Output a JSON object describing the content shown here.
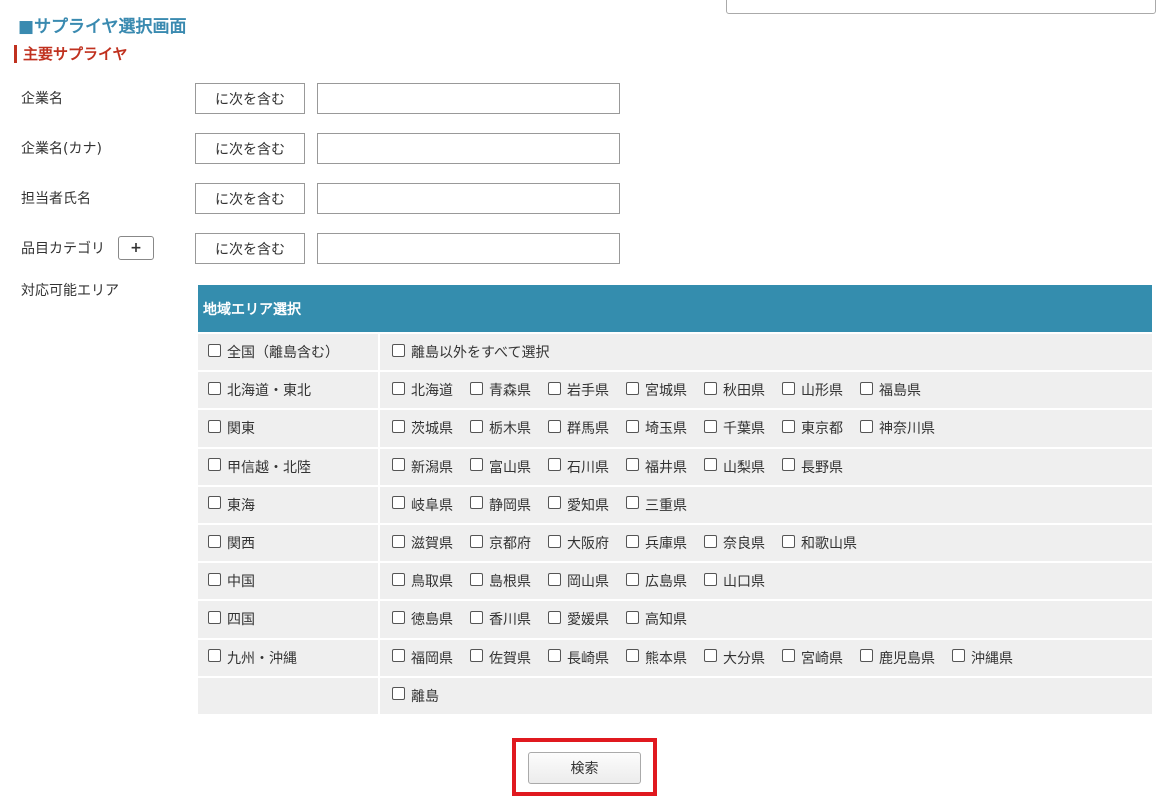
{
  "page": {
    "title": "サプライヤ選択画面",
    "title_marker": "■",
    "subtitle": "主要サプライヤ"
  },
  "fields": [
    {
      "label": "企業名",
      "condition": "に次を含む",
      "value": ""
    },
    {
      "label": "企業名(カナ)",
      "condition": "に次を含む",
      "value": ""
    },
    {
      "label": "担当者氏名",
      "condition": "に次を含む",
      "value": ""
    },
    {
      "label": "品目カテゴリ",
      "condition": "に次を含む",
      "value": ""
    }
  ],
  "category_add_label": "+",
  "area": {
    "label": "対応可能エリア",
    "header": "地域エリア選択",
    "rows": [
      {
        "region": "全国（離島含む）",
        "prefectures": [
          "離島以外をすべて選択"
        ]
      },
      {
        "region": "北海道・東北",
        "prefectures": [
          "北海道",
          "青森県",
          "岩手県",
          "宮城県",
          "秋田県",
          "山形県",
          "福島県"
        ]
      },
      {
        "region": "関東",
        "prefectures": [
          "茨城県",
          "栃木県",
          "群馬県",
          "埼玉県",
          "千葉県",
          "東京都",
          "神奈川県"
        ]
      },
      {
        "region": "甲信越・北陸",
        "prefectures": [
          "新潟県",
          "富山県",
          "石川県",
          "福井県",
          "山梨県",
          "長野県"
        ]
      },
      {
        "region": "東海",
        "prefectures": [
          "岐阜県",
          "静岡県",
          "愛知県",
          "三重県"
        ]
      },
      {
        "region": "関西",
        "prefectures": [
          "滋賀県",
          "京都府",
          "大阪府",
          "兵庫県",
          "奈良県",
          "和歌山県"
        ]
      },
      {
        "region": "中国",
        "prefectures": [
          "鳥取県",
          "島根県",
          "岡山県",
          "広島県",
          "山口県"
        ]
      },
      {
        "region": "四国",
        "prefectures": [
          "徳島県",
          "香川県",
          "愛媛県",
          "高知県"
        ]
      },
      {
        "region": "九州・沖縄",
        "prefectures": [
          "福岡県",
          "佐賀県",
          "長崎県",
          "熊本県",
          "大分県",
          "宮崎県",
          "鹿児島県",
          "沖縄県"
        ]
      },
      {
        "region": "",
        "prefectures": [
          "離島"
        ]
      }
    ]
  },
  "search_label": "検索",
  "colors": {
    "title": "#3a8ab0",
    "subtitle": "#c0311f",
    "area_header": "#348dae",
    "highlight": "#e0191f"
  }
}
